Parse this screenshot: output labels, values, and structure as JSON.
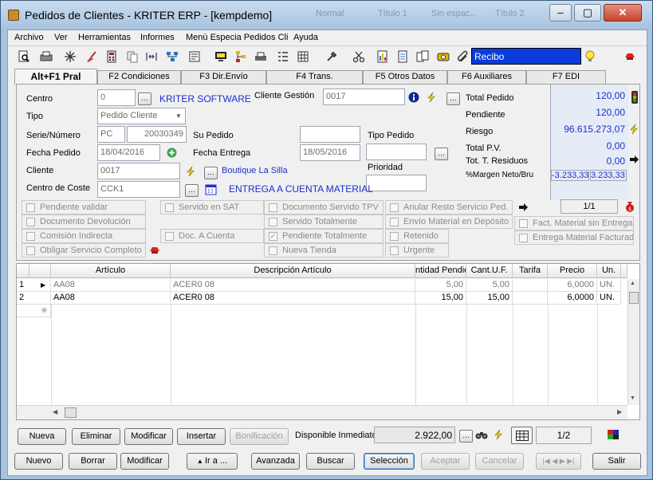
{
  "window": {
    "title": "Pedidos de Clientes - KRITER ERP - [kempdemo]",
    "ghost_titles": [
      "Normal",
      "Título 1",
      "Sin espac...",
      "Título 2"
    ]
  },
  "menu": [
    "Archivo",
    "Ver",
    "Herramientas",
    "Informes",
    "Menú Especia Pedidos Cli",
    "Ayuda"
  ],
  "toolbar": {
    "recibo": "Recibo",
    "icons": [
      "preview-icon",
      "print-icon",
      "sparkle-icon",
      "broom-icon",
      "calculator-icon",
      "copy-icon",
      "split-icon",
      "tree-icon",
      "form-icon",
      "monitor-icon",
      "org-icon",
      "printer2-icon",
      "list-icon",
      "grid-icon",
      "tools-icon",
      "scissors-icon",
      "report-icon",
      "doc-icon",
      "pages-icon",
      "stamp-icon",
      "clip-icon"
    ]
  },
  "tabs": [
    "Alt+F1 Pral",
    "F2 Condiciones",
    "F3 Dir.Envío",
    "F4 Trans.",
    "F5 Otros Datos",
    "F6 Auxiliares",
    "F7 EDI"
  ],
  "form": {
    "centro_label": "Centro",
    "centro_value": "0",
    "centro_name": "KRITER SOFTWARE",
    "cliente_gestion_label": "Cliente Gestión",
    "cliente_gestion_value": "0017",
    "tipo_label": "Tipo",
    "tipo_value": "Pedido Cliente",
    "serie_label": "Serie/Número",
    "serie_value": "PC",
    "numero_value": "20030349",
    "su_pedido_label": "Su Pedido",
    "su_pedido_value": "",
    "tipo_pedido_label": "Tipo Pedido",
    "tipo_pedido_value": "",
    "fecha_pedido_label": "Fecha Pedido",
    "fecha_pedido_value": "18/04/2016",
    "fecha_entrega_label": "Fecha Entrega",
    "fecha_entrega_value": "18/05/2016",
    "prioridad_label": "Prioridad",
    "prioridad_value": "",
    "cliente_label": "Cliente",
    "cliente_value": "0017",
    "cliente_name": "Boutique La Silla",
    "centro_coste_label": "Centro de Coste",
    "centro_coste_value": "CCK1",
    "entrega_text": "ENTREGA A CUENTA MATERIAL"
  },
  "totals": {
    "total_pedido_label": "Total Pedido",
    "total_pedido": "120,00",
    "pendiente_label": "Pendiente",
    "pendiente": "120,00",
    "riesgo_label": "Riesgo",
    "riesgo": "96.615.273,07",
    "total_pv_label": "Total P.V.",
    "total_pv": "0,00",
    "tot_residuos_label": "Tot. T. Residuos",
    "tot_residuos": "0,00",
    "margen_label": "%Margen Neto/Bru",
    "margen_neto": "-3.233,33",
    "margen_bruto": "3.233,33"
  },
  "checks": {
    "c1": [
      "Pendiente validar",
      "Documento Devolución",
      "Comisión Indirecta",
      "Obligar Servicio Completo"
    ],
    "c2": [
      "Servido en SAT",
      "Doc. A Cuenta"
    ],
    "c3": [
      "Documento Servido TPV",
      "Servido Totalmente",
      "Pendiente Totalmente",
      "Nueva Tienda"
    ],
    "c4": [
      "Anular Resto Servicio Ped.",
      "Envío Material en Depósito",
      "Retenido",
      "Urgente"
    ],
    "c5": [
      "Fact. Material sin Entrega",
      "Entrega Material Facturad"
    ],
    "page": "1/1"
  },
  "grid": {
    "headers": [
      "Artículo",
      "Descripción Artículo",
      "ntidad Pendie",
      "Cant.U.F.",
      "Tarifa",
      "Precio",
      "Un."
    ],
    "rows": [
      {
        "n": "1",
        "articulo": "AA08",
        "descripcion": "ACER0 08",
        "pendiente": "5,00",
        "cantuf": "5,00",
        "tarifa": "",
        "precio": "6,0000",
        "un": "UN."
      },
      {
        "n": "2",
        "articulo": "AA08",
        "descripcion": "ACER0 08",
        "pendiente": "15,00",
        "cantuf": "15,00",
        "tarifa": "",
        "precio": "6,0000",
        "un": "UN."
      }
    ]
  },
  "line_buttons": {
    "nueva": "Nueva",
    "eliminar": "Eliminar",
    "modificar": "Modificar",
    "insertar": "Insertar",
    "bonificacion": "Bonificación",
    "disponible_label": "Disponible Inmediato",
    "disponible": "2.922,00",
    "page": "1/2"
  },
  "bottom_buttons": {
    "nuevo": "Nuevo",
    "borrar": "Borrar",
    "modificar": "Modificar",
    "ira": "Ir a ...",
    "avanzada": "Avanzada",
    "buscar": "Buscar",
    "seleccion": "Selección",
    "aceptar": "Aceptar",
    "cancelar": "Cancelar",
    "salir": "Salir"
  }
}
